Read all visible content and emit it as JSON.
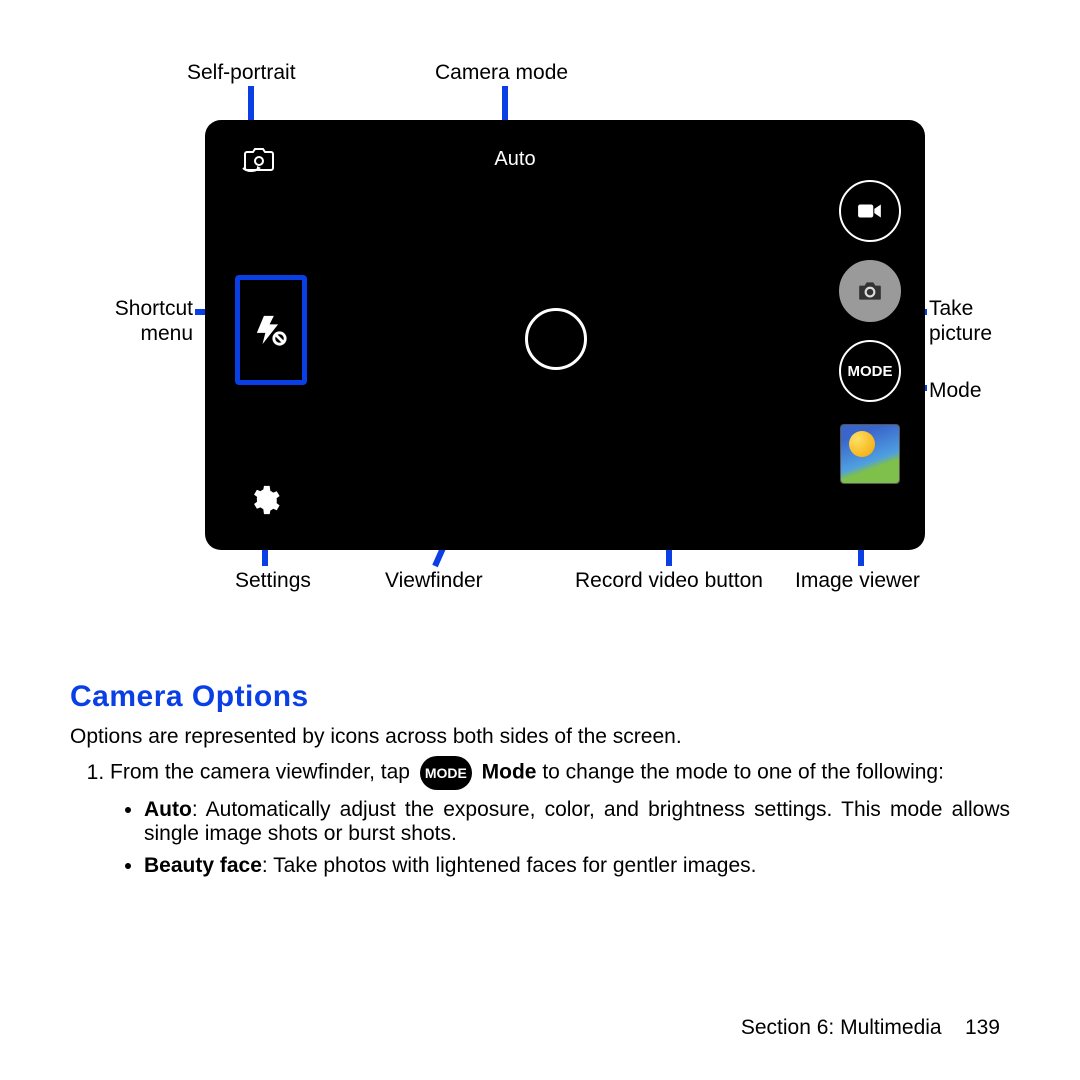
{
  "diagram": {
    "callouts": {
      "self_portrait": "Self-portrait",
      "camera_mode": "Camera mode",
      "shortcut_menu": "Shortcut menu",
      "take_picture": "Take picture",
      "mode": "Mode",
      "settings": "Settings",
      "viewfinder": "Viewfinder",
      "record_video": "Record video button",
      "image_viewer": "Image viewer"
    },
    "screen": {
      "mode_label": "Auto",
      "mode_button_text": "MODE"
    }
  },
  "content": {
    "heading": "Camera Options",
    "intro": "Options are represented by icons across both sides of the screen.",
    "step1_before": "From the camera viewfinder, tap",
    "step1_mode_icon_text": "MODE",
    "step1_mode_bold": "Mode",
    "step1_after": "to change the mode to one of the following:",
    "bullets": {
      "auto_label": "Auto",
      "auto_text": ": Automatically adjust the exposure, color, and brightness settings. This mode allows single image shots or burst shots.",
      "beauty_label": "Beauty face",
      "beauty_text": ": Take photos with lightened faces for gentler images."
    }
  },
  "footer": {
    "section": "Section 6:  Multimedia",
    "page": "139"
  }
}
